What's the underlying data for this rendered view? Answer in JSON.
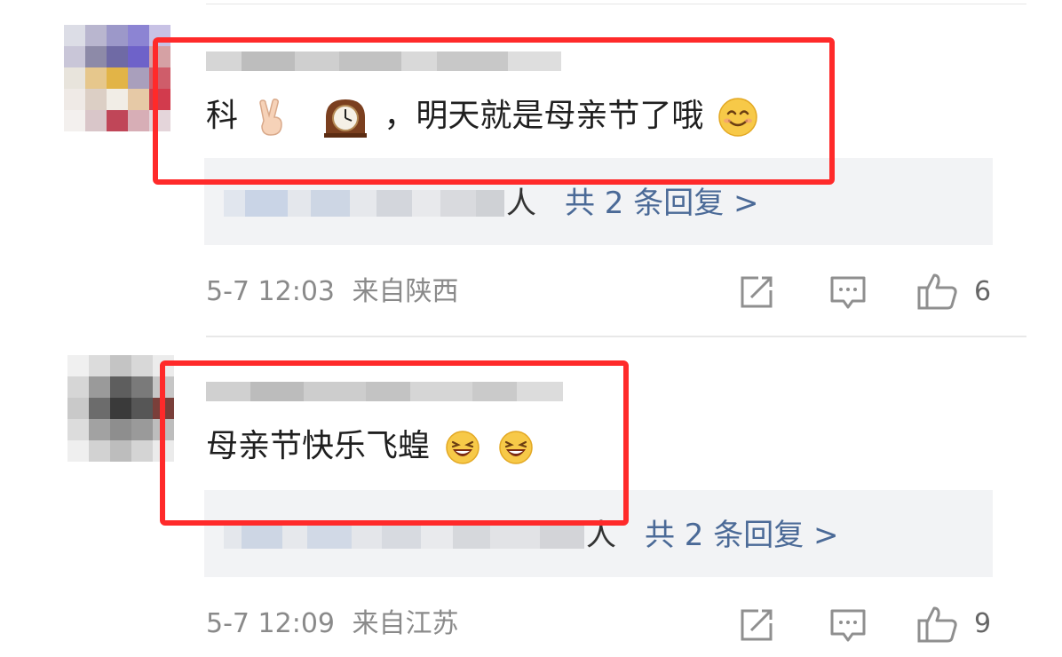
{
  "comments": [
    {
      "text": "科✌️🕰️，明天就是母亲节了哦😊",
      "text_prefix": "科",
      "text_main": "，明天就是母亲节了哦",
      "reply_tail": "人",
      "reply_link": "共 2 条回复 >",
      "time": "5-7 12:03",
      "location": "来自陕西",
      "likes": "6"
    },
    {
      "text": "母亲节快乐飞蝗😆😆",
      "text_main": "母亲节快乐飞蝗",
      "reply_tail": "人",
      "reply_link": "共 2 条回复 >",
      "time": "5-7 12:09",
      "location": "来自江苏",
      "likes": "9"
    }
  ],
  "icons": [
    "share-icon",
    "comment-icon",
    "like-icon"
  ],
  "colors": {
    "highlight": "#ff2a2a",
    "link": "#4b6a97",
    "meta": "#8a8a8a",
    "reply_bg": "#f2f3f5"
  }
}
